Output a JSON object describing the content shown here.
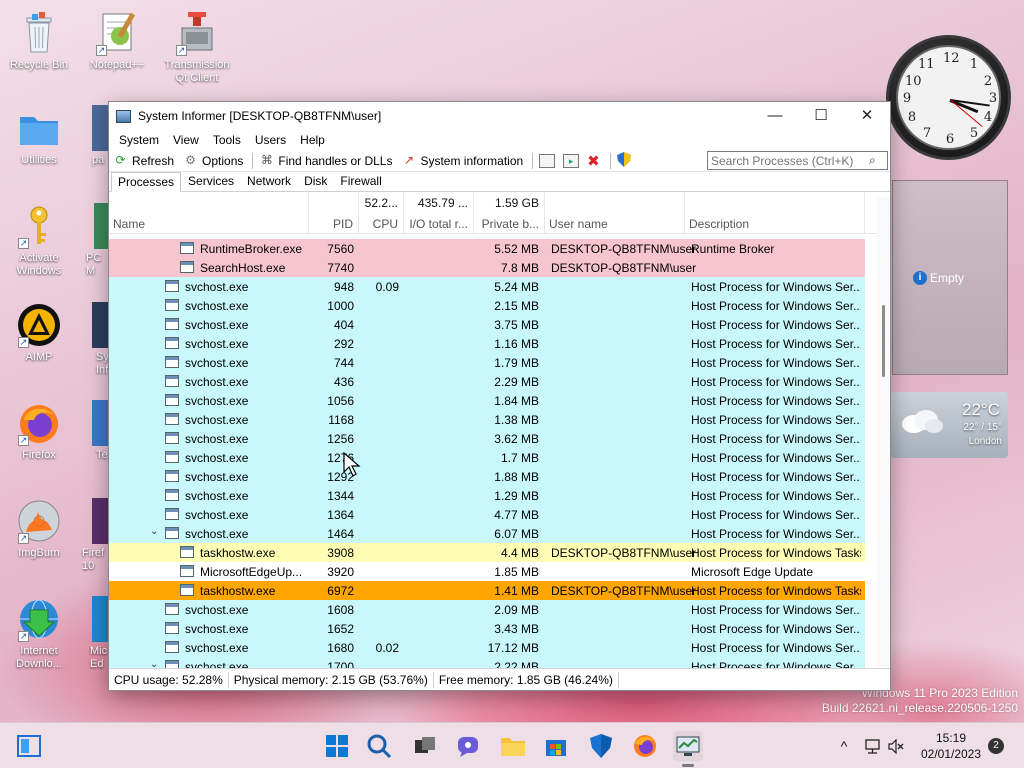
{
  "desktop": {
    "icons": [
      {
        "name": "recycle-bin",
        "label": "Recycle Bin"
      },
      {
        "name": "notepad",
        "label": "Notepad++"
      },
      {
        "name": "transmission",
        "label": "Transmission\nQt Client"
      },
      {
        "name": "utilities",
        "label": "Utilities"
      },
      {
        "name": "activate-windows",
        "label": "Activate\nWindows"
      },
      {
        "name": "aimp",
        "label": "AIMP"
      },
      {
        "name": "firefox",
        "label": "Firefox"
      },
      {
        "name": "imgburn",
        "label": "ImgBurn"
      },
      {
        "name": "internet-download",
        "label": "Internet\nDownlo..."
      }
    ],
    "partial_labels": [
      "pa",
      "PC M",
      "Sy\nInf",
      "Te",
      "Firef\n10",
      "Mic\nEd"
    ]
  },
  "window": {
    "title": "System Informer [DESKTOP-QB8TFNM\\user]",
    "menu": [
      "System",
      "View",
      "Tools",
      "Users",
      "Help"
    ],
    "toolbar": {
      "refresh": "Refresh",
      "options": "Options",
      "find_handles": "Find handles or DLLs",
      "system_information": "System information",
      "search_placeholder": "Search Processes (Ctrl+K)"
    },
    "tabs": [
      "Processes",
      "Services",
      "Network",
      "Disk",
      "Firewall"
    ],
    "columns": {
      "name": "Name",
      "pid": "PID",
      "cpu": "CPU",
      "cpu_total": "52.2...",
      "io": "I/O total r...",
      "io_total": "435.79 ...",
      "private": "Private b...",
      "private_total": "1.59 GB",
      "user": "User name",
      "description": "Description"
    },
    "rows": [
      {
        "name": "RuntimeBroker.exe",
        "pid": "7560",
        "cpu": "",
        "private": "5.52 MB",
        "user": "DESKTOP-QB8TFNM\\user",
        "desc": "Runtime Broker",
        "color": "#f7c5d0",
        "indent": 2
      },
      {
        "name": "SearchHost.exe",
        "pid": "7740",
        "cpu": "",
        "private": "7.8 MB",
        "user": "DESKTOP-QB8TFNM\\user",
        "desc": "",
        "color": "#f7c5d0",
        "indent": 2
      },
      {
        "name": "svchost.exe",
        "pid": "948",
        "cpu": "0.09",
        "private": "5.24 MB",
        "user": "",
        "desc": "Host Process for Windows Ser...",
        "color": "#c8f8fb",
        "indent": 1
      },
      {
        "name": "svchost.exe",
        "pid": "1000",
        "cpu": "",
        "private": "2.15 MB",
        "user": "",
        "desc": "Host Process for Windows Ser...",
        "color": "#c8f8fb",
        "indent": 1
      },
      {
        "name": "svchost.exe",
        "pid": "404",
        "cpu": "",
        "private": "3.75 MB",
        "user": "",
        "desc": "Host Process for Windows Ser...",
        "color": "#c8f8fb",
        "indent": 1
      },
      {
        "name": "svchost.exe",
        "pid": "292",
        "cpu": "",
        "private": "1.16 MB",
        "user": "",
        "desc": "Host Process for Windows Ser...",
        "color": "#c8f8fb",
        "indent": 1
      },
      {
        "name": "svchost.exe",
        "pid": "744",
        "cpu": "",
        "private": "1.79 MB",
        "user": "",
        "desc": "Host Process for Windows Ser...",
        "color": "#c8f8fb",
        "indent": 1
      },
      {
        "name": "svchost.exe",
        "pid": "436",
        "cpu": "",
        "private": "2.29 MB",
        "user": "",
        "desc": "Host Process for Windows Ser...",
        "color": "#c8f8fb",
        "indent": 1
      },
      {
        "name": "svchost.exe",
        "pid": "1056",
        "cpu": "",
        "private": "1.84 MB",
        "user": "",
        "desc": "Host Process for Windows Ser...",
        "color": "#c8f8fb",
        "indent": 1
      },
      {
        "name": "svchost.exe",
        "pid": "1168",
        "cpu": "",
        "private": "1.38 MB",
        "user": "",
        "desc": "Host Process for Windows Ser...",
        "color": "#c8f8fb",
        "indent": 1
      },
      {
        "name": "svchost.exe",
        "pid": "1256",
        "cpu": "",
        "private": "3.62 MB",
        "user": "",
        "desc": "Host Process for Windows Ser...",
        "color": "#c8f8fb",
        "indent": 1
      },
      {
        "name": "svchost.exe",
        "pid": "1276",
        "cpu": "",
        "private": "1.7 MB",
        "user": "",
        "desc": "Host Process for Windows Ser...",
        "color": "#c8f8fb",
        "indent": 1
      },
      {
        "name": "svchost.exe",
        "pid": "1292",
        "cpu": "",
        "private": "1.88 MB",
        "user": "",
        "desc": "Host Process for Windows Ser...",
        "color": "#c8f8fb",
        "indent": 1
      },
      {
        "name": "svchost.exe",
        "pid": "1344",
        "cpu": "",
        "private": "1.29 MB",
        "user": "",
        "desc": "Host Process for Windows Ser...",
        "color": "#c8f8fb",
        "indent": 1
      },
      {
        "name": "svchost.exe",
        "pid": "1364",
        "cpu": "",
        "private": "4.77 MB",
        "user": "",
        "desc": "Host Process for Windows Ser...",
        "color": "#c8f8fb",
        "indent": 1
      },
      {
        "name": "svchost.exe",
        "pid": "1464",
        "cpu": "",
        "private": "6.07 MB",
        "user": "",
        "desc": "Host Process for Windows Ser...",
        "color": "#c8f8fb",
        "indent": 1,
        "expanded": true
      },
      {
        "name": "taskhostw.exe",
        "pid": "3908",
        "cpu": "",
        "private": "4.4 MB",
        "user": "DESKTOP-QB8TFNM\\user",
        "desc": "Host Process for Windows Tasks",
        "color": "#fdfdb4",
        "indent": 2
      },
      {
        "name": "MicrosoftEdgeUp...",
        "pid": "3920",
        "cpu": "",
        "private": "1.85 MB",
        "user": "",
        "desc": "Microsoft Edge Update",
        "color": "#ffffff",
        "indent": 2
      },
      {
        "name": "taskhostw.exe",
        "pid": "6972",
        "cpu": "",
        "private": "1.41 MB",
        "user": "DESKTOP-QB8TFNM\\user",
        "desc": "Host Process for Windows Tasks",
        "color": "#ffa500",
        "indent": 2
      },
      {
        "name": "svchost.exe",
        "pid": "1608",
        "cpu": "",
        "private": "2.09 MB",
        "user": "",
        "desc": "Host Process for Windows Ser...",
        "color": "#c8f8fb",
        "indent": 1
      },
      {
        "name": "svchost.exe",
        "pid": "1652",
        "cpu": "",
        "private": "3.43 MB",
        "user": "",
        "desc": "Host Process for Windows Ser...",
        "color": "#c8f8fb",
        "indent": 1
      },
      {
        "name": "svchost.exe",
        "pid": "1680",
        "cpu": "0.02",
        "private": "17.12 MB",
        "user": "",
        "desc": "Host Process for Windows Ser...",
        "color": "#c8f8fb",
        "indent": 1
      },
      {
        "name": "svchost.exe",
        "pid": "1700",
        "cpu": "",
        "private": "2.22 MB",
        "user": "",
        "desc": "Host Process for Windows Ser...",
        "color": "#c8f8fb",
        "indent": 1,
        "expanded": true
      }
    ],
    "status": {
      "cpu": "CPU usage: 52.28%",
      "physical": "Physical memory: 2.15 GB (53.76%)",
      "free": "Free memory: 1.85 GB (46.24%)"
    }
  },
  "widgets": {
    "clock_numbers": [
      "12",
      "1",
      "2",
      "3",
      "4",
      "5",
      "6",
      "7",
      "8",
      "9",
      "10",
      "11"
    ],
    "empty_label": "Empty",
    "weather": {
      "temp": "22°C",
      "range": "22° / 15°",
      "city": "London"
    }
  },
  "watermark": {
    "line1": "Windows 11 Pro 2023 Edition",
    "line2": "Build 22621.ni_release.220506-1250"
  },
  "taskbar": {
    "time": "15:19",
    "date": "02/01/2023",
    "notifications": "2"
  }
}
